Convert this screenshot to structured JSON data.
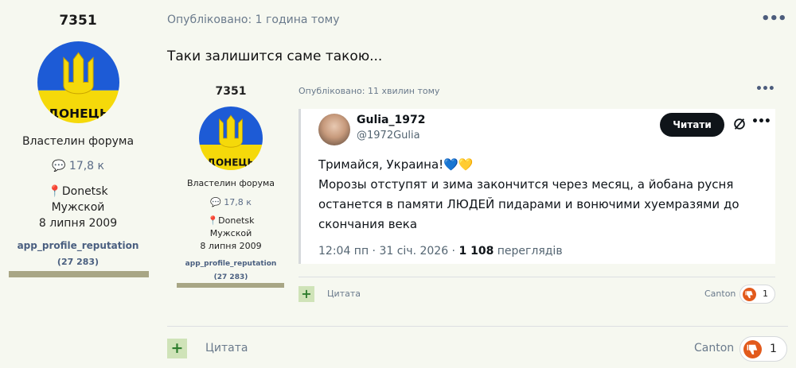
{
  "post": {
    "author": {
      "name": "7351",
      "avatar_text": "ДОНЕЦЬ",
      "title": "Властелин форума",
      "posts": "17,8 к",
      "location": "Donetsk",
      "gender": "Мужской",
      "joined": "8 липня 2009",
      "reputation_label": "app_profile_reputation",
      "reputation_value": "(27 283)"
    },
    "published": "Опубліковано: 1 година тому",
    "text": "Таки залишится саме такою...",
    "quote_label": "Цитата",
    "reaction_user": "Canton",
    "reaction_count": "1"
  },
  "quoted": {
    "author": {
      "name": "7351",
      "avatar_text": "ДОНЕЦЬ",
      "title": "Властелин форума",
      "posts": "17,8 к",
      "location": "Donetsk",
      "gender": "Мужской",
      "joined": "8 липня 2009",
      "reputation_label": "app_profile_reputation",
      "reputation_value": "(27 283)"
    },
    "published": "Опубліковано: 11 хвилин тому",
    "quote_label": "Цитата",
    "reaction_user": "Canton",
    "reaction_count": "1"
  },
  "tweet": {
    "name": "Gulia_1972",
    "handle": "@1972Gulia",
    "read_button": "Читати",
    "line1": "Тримайся, Украина!💙💛",
    "line2": "Морозы отступят и зима закончится через месяц, а йобана русня останется в памяти ЛЮДЕЙ пидарами и вонючими хуемразями до скончания века",
    "time": "12:04 пп · 31 січ. 2026 · ",
    "views_count": "1 108",
    "views_label": " переглядів"
  },
  "colors": {
    "flag_blue": "#1d5bd6",
    "flag_yellow": "#f5d90a",
    "reaction": "#e25a1c",
    "plus_bg": "#cfe3b8"
  }
}
